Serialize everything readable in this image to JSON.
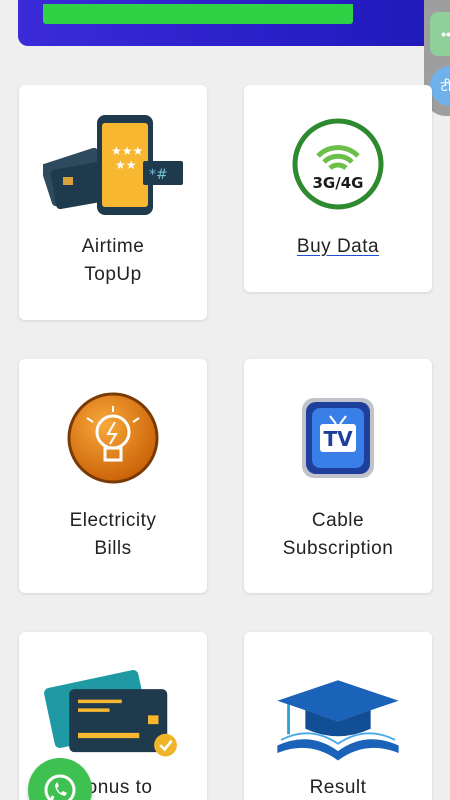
{
  "services": [
    {
      "id": "airtime",
      "label": "Airtime\nTopUp",
      "icon": "phone-cards-icon"
    },
    {
      "id": "data",
      "label": "Buy Data",
      "icon": "wifi-3g4g-icon"
    },
    {
      "id": "electricity",
      "label": "Electricity\nBills",
      "icon": "lightbulb-icon"
    },
    {
      "id": "cable",
      "label": "Cable\nSubscription",
      "icon": "tv-icon"
    },
    {
      "id": "bonus",
      "label": "Bonus to",
      "icon": "credit-card-icon"
    },
    {
      "id": "result",
      "label": "Result",
      "icon": "graduation-cap-icon"
    }
  ],
  "data_icon_text": "3G/4G",
  "tv_icon_text": "TV",
  "side_float": {
    "btn1": "••",
    "btn2": "टी"
  },
  "colors": {
    "banner": "#2a1fc9",
    "banner_accent": "#2fd245",
    "whatsapp": "#3fc152"
  }
}
